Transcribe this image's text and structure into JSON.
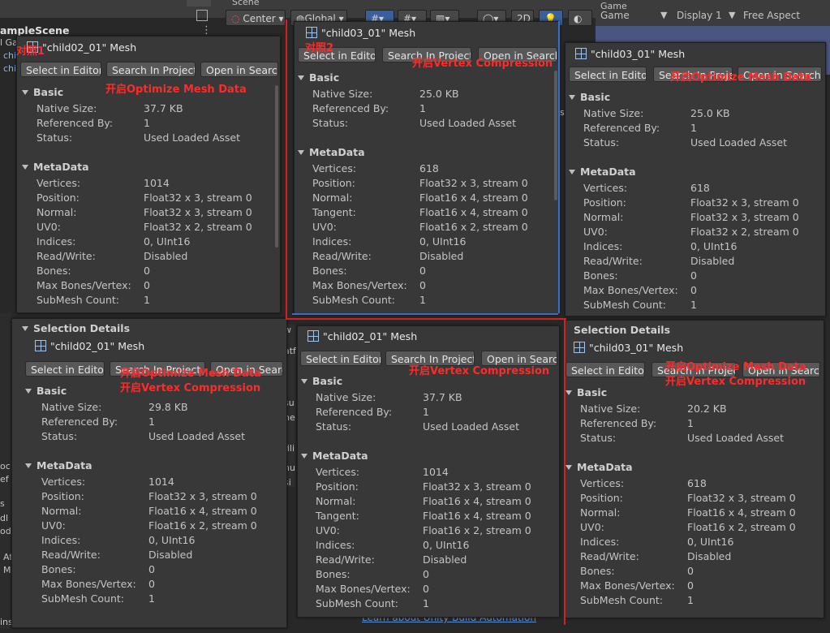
{
  "background": {
    "scene_tab": "Scene",
    "game_tab": "Game",
    "scene_name": "ampleScene",
    "center_label": "Center",
    "global_label": "Global",
    "mode_2d": "2D",
    "game_dropdown": "Game",
    "display_dropdown": "Display 1",
    "aspect_label": "Free Aspect",
    "left_fragments": [
      "l Ga",
      "chi",
      "chi"
    ],
    "mid_fragments": [
      "sp",
      "w",
      "atf",
      "su",
      "ne",
      "fili",
      "nu",
      "si"
    ],
    "bottom_left_fragments": [
      "oc",
      "ef",
      "s",
      "dl",
      "od",
      "At",
      "M",
      "ins"
    ],
    "learn_link": "Learn about Unity Build Automation"
  },
  "panels": [
    {
      "title": "\"child02_01\" Mesh",
      "buttons": [
        "Select in Editor",
        "Search In Project",
        "Open in Search"
      ],
      "basic_label": "Basic",
      "basic": [
        [
          "Native Size:",
          "37.7 KB"
        ],
        [
          "Referenced By:",
          "1"
        ],
        [
          "Status:",
          "Used Loaded Asset"
        ]
      ],
      "meta_label": "MetaData",
      "meta": [
        [
          "Vertices:",
          "1014"
        ],
        [
          "Position:",
          "Float32 x 3, stream 0"
        ],
        [
          "Normal:",
          "Float32 x 3, stream 0"
        ],
        [
          "UV0:",
          "Float32 x 2, stream 0"
        ],
        [
          "Indices:",
          "0, UInt16"
        ],
        [
          "Read/Write:",
          "Disabled"
        ],
        [
          "Bones:",
          "0"
        ],
        [
          "Max Bones/Vertex:",
          "0"
        ],
        [
          "SubMesh Count:",
          "1"
        ]
      ],
      "annotations": [
        "对照1",
        "开启Optimize Mesh Data"
      ]
    },
    {
      "title": "\"child03_01\" Mesh",
      "buttons": [
        "Select in Editor",
        "Search In Project",
        "Open in Search"
      ],
      "basic_label": "Basic",
      "basic": [
        [
          "Native Size:",
          "25.0 KB"
        ],
        [
          "Referenced By:",
          "1"
        ],
        [
          "Status:",
          "Used Loaded Asset"
        ]
      ],
      "meta_label": "MetaData",
      "meta": [
        [
          "Vertices:",
          "618"
        ],
        [
          "Position:",
          "Float32 x 3, stream 0"
        ],
        [
          "Normal:",
          "Float16 x 4, stream 0"
        ],
        [
          "Tangent:",
          "Float16 x 4, stream 0"
        ],
        [
          "UV0:",
          "Float16 x 2, stream 0"
        ],
        [
          "Indices:",
          "0, UInt16"
        ],
        [
          "Read/Write:",
          "Disabled"
        ],
        [
          "Bones:",
          "0"
        ],
        [
          "Max Bones/Vertex:",
          "0"
        ],
        [
          "SubMesh Count:",
          "1"
        ]
      ],
      "annotations": [
        "对照2",
        "开启Vertex Compression"
      ]
    },
    {
      "title": "\"child03_01\" Mesh",
      "buttons": [
        "Select in Editor",
        "Search In Project",
        "Open in Search"
      ],
      "basic_label": "Basic",
      "basic": [
        [
          "Native Size:",
          "25.0 KB"
        ],
        [
          "Referenced By:",
          "1"
        ],
        [
          "Status:",
          "Used Loaded Asset"
        ]
      ],
      "meta_label": "MetaData",
      "meta": [
        [
          "Vertices:",
          "618"
        ],
        [
          "Position:",
          "Float32 x 3, stream 0"
        ],
        [
          "Normal:",
          "Float32 x 3, stream 0"
        ],
        [
          "UV0:",
          "Float32 x 2, stream 0"
        ],
        [
          "Indices:",
          "0, UInt16"
        ],
        [
          "Read/Write:",
          "Disabled"
        ],
        [
          "Bones:",
          "0"
        ],
        [
          "Max Bones/Vertex:",
          "0"
        ],
        [
          "SubMesh Count:",
          "1"
        ]
      ],
      "annotations": [
        "开启Optimize Mesh Data"
      ]
    },
    {
      "header": "Selection Details",
      "title": "\"child02_01\" Mesh",
      "buttons": [
        "Select in Editor",
        "Search In Project",
        "Open in Search"
      ],
      "basic_label": "Basic",
      "basic": [
        [
          "Native Size:",
          "29.8 KB"
        ],
        [
          "Referenced By:",
          "1"
        ],
        [
          "Status:",
          "Used Loaded Asset"
        ]
      ],
      "meta_label": "MetaData",
      "meta": [
        [
          "Vertices:",
          "1014"
        ],
        [
          "Position:",
          "Float32 x 3, stream 0"
        ],
        [
          "Normal:",
          "Float16 x 4, stream 0"
        ],
        [
          "UV0:",
          "Float16 x 2, stream 0"
        ],
        [
          "Indices:",
          "0, UInt16"
        ],
        [
          "Read/Write:",
          "Disabled"
        ],
        [
          "Bones:",
          "0"
        ],
        [
          "Max Bones/Vertex:",
          "0"
        ],
        [
          "SubMesh Count:",
          "1"
        ]
      ],
      "annotations": [
        "开启Optimize Mesh Data",
        "开启Vertex Compression"
      ]
    },
    {
      "title": "\"child02_01\" Mesh",
      "buttons": [
        "Select in Editor",
        "Search In Project",
        "Open in Search"
      ],
      "basic_label": "Basic",
      "basic": [
        [
          "Native Size:",
          "37.7 KB"
        ],
        [
          "Referenced By:",
          "1"
        ],
        [
          "Status:",
          "Used Loaded Asset"
        ]
      ],
      "meta_label": "MetaData",
      "meta": [
        [
          "Vertices:",
          "1014"
        ],
        [
          "Position:",
          "Float32 x 3, stream 0"
        ],
        [
          "Normal:",
          "Float16 x 4, stream 0"
        ],
        [
          "Tangent:",
          "Float16 x 4, stream 0"
        ],
        [
          "UV0:",
          "Float16 x 2, stream 0"
        ],
        [
          "Indices:",
          "0, UInt16"
        ],
        [
          "Read/Write:",
          "Disabled"
        ],
        [
          "Bones:",
          "0"
        ],
        [
          "Max Bones/Vertex:",
          "0"
        ],
        [
          "SubMesh Count:",
          "1"
        ]
      ],
      "annotations": [
        "开启Vertex Compression"
      ]
    },
    {
      "header": "Selection Details",
      "title": "\"child03_01\" Mesh",
      "buttons": [
        "Select in Editor",
        "Search In Project",
        "Open in Search"
      ],
      "basic_label": "Basic",
      "basic": [
        [
          "Native Size:",
          "20.2 KB"
        ],
        [
          "Referenced By:",
          "1"
        ],
        [
          "Status:",
          "Used Loaded Asset"
        ]
      ],
      "meta_label": "MetaData",
      "meta": [
        [
          "Vertices:",
          "618"
        ],
        [
          "Position:",
          "Float32 x 3, stream 0"
        ],
        [
          "Normal:",
          "Float16 x 4, stream 0"
        ],
        [
          "UV0:",
          "Float16 x 2, stream 0"
        ],
        [
          "Indices:",
          "0, UInt16"
        ],
        [
          "Read/Write:",
          "Disabled"
        ],
        [
          "Bones:",
          "0"
        ],
        [
          "Max Bones/Vertex:",
          "0"
        ],
        [
          "SubMesh Count:",
          "1"
        ]
      ],
      "annotations": [
        "开启Optimize Mesh Data",
        "开启Vertex Compression"
      ]
    }
  ],
  "colors": {
    "annotation": "#ff2a2a",
    "panel_bg": "#383838",
    "button_bg": "#585858"
  }
}
